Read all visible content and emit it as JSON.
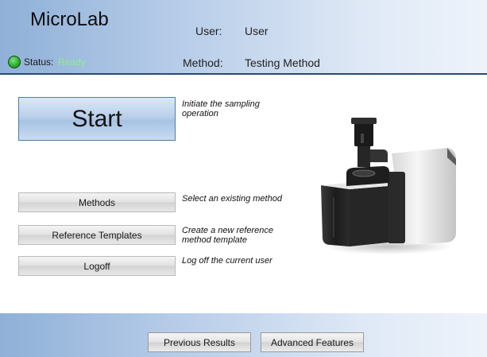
{
  "header": {
    "app_title": "MicroLab",
    "user_label": "User:",
    "user_value": "User",
    "method_label": "Method:",
    "method_value": "Testing Method",
    "status_label": "Status:",
    "status_value": "Ready",
    "status_color": "#2fb02f"
  },
  "main": {
    "start": {
      "label": "Start",
      "description": "Initiate the sampling operation"
    },
    "buttons": [
      {
        "label": "Methods",
        "description": "Select an existing method"
      },
      {
        "label": "Reference Templates",
        "description": "Create a new reference method template"
      },
      {
        "label": "Logoff",
        "description": "Log off the current user"
      }
    ]
  },
  "footer": {
    "previous_results": "Previous Results",
    "advanced_features": "Advanced Features"
  },
  "colors": {
    "header_gradient_start": "#8fb0d8",
    "header_gradient_end": "#eef3fa",
    "start_button_border": "#4f7ca8",
    "status_text": "#8fef8f"
  }
}
